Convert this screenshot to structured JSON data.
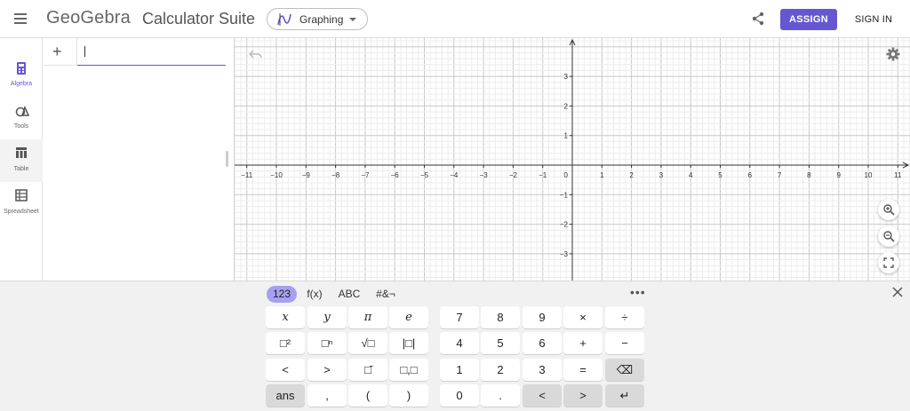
{
  "header": {
    "logo": "GeoGebra",
    "suite_title": "Calculator Suite",
    "app_select": "Graphing",
    "assign": "ASSIGN",
    "sign_in": "SIGN IN"
  },
  "sidebar": {
    "items": [
      {
        "label": "Algebra",
        "icon": "calculator-icon"
      },
      {
        "label": "Tools",
        "icon": "tools-icon"
      },
      {
        "label": "Table",
        "icon": "table-icon"
      },
      {
        "label": "Spreadsheet",
        "icon": "spreadsheet-icon"
      }
    ]
  },
  "algebra": {
    "add_symbol": "+"
  },
  "graph": {
    "x_ticks": [
      "−11",
      "−10",
      "−9",
      "−8",
      "−7",
      "−6",
      "−5",
      "−4",
      "−3",
      "−2",
      "−1",
      "1",
      "2",
      "3",
      "4",
      "5",
      "6",
      "7",
      "8",
      "9",
      "10",
      "11"
    ],
    "y_ticks": [
      "3",
      "2",
      "1",
      "−1",
      "−2",
      "−3"
    ],
    "origin_label": "0"
  },
  "keyboard": {
    "tabs": [
      "123",
      "f(x)",
      "ABC",
      "#&¬"
    ],
    "more": "•••",
    "keys": [
      [
        "x",
        "y",
        "π",
        "e",
        "7",
        "8",
        "9",
        "×",
        "÷"
      ],
      [
        "□²",
        "□ⁿ",
        "√□",
        "|□|",
        "4",
        "5",
        "6",
        "+",
        "−"
      ],
      [
        "<",
        ">",
        "□̄",
        "□,□",
        "1",
        "2",
        "3",
        "=",
        "⌫"
      ],
      [
        "ans",
        ",",
        "(",
        ")",
        "0",
        ".",
        "<",
        ">",
        "↵"
      ]
    ]
  },
  "colors": {
    "accent": "#6557d2",
    "active_tab": "#a79ff0",
    "keyboard_bg": "#f1f1f1"
  }
}
